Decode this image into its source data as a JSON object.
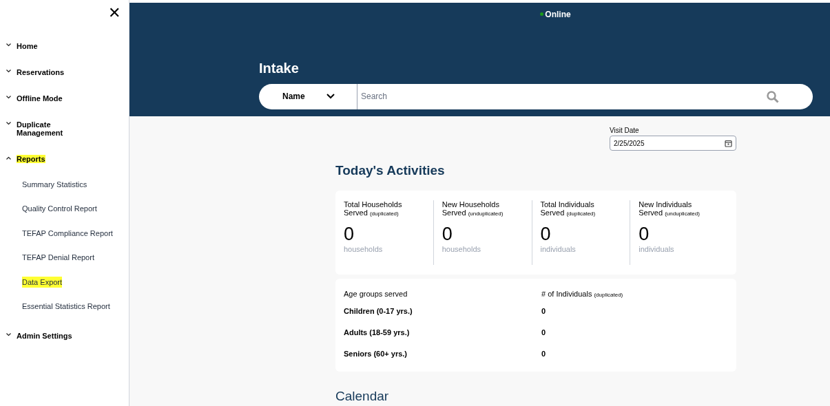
{
  "sidebar": {
    "close": "✕",
    "items": [
      {
        "label": "Home",
        "expanded": false,
        "highlighted": false
      },
      {
        "label": "Reservations",
        "expanded": false,
        "highlighted": false
      },
      {
        "label": "Offline Mode",
        "expanded": false,
        "highlighted": false
      },
      {
        "label": "Duplicate Management",
        "expanded": false,
        "highlighted": false
      },
      {
        "label": "Reports",
        "expanded": true,
        "highlighted": true,
        "children": [
          {
            "label": "Summary Statistics",
            "highlighted": false
          },
          {
            "label": "Quality Control Report",
            "highlighted": false
          },
          {
            "label": "TEFAP Compliance Report",
            "highlighted": false
          },
          {
            "label": "TEFAP Denial Report",
            "highlighted": false
          },
          {
            "label": "Data Export",
            "highlighted": true
          },
          {
            "label": "Essential Statistics Report",
            "highlighted": false
          }
        ]
      },
      {
        "label": "Admin Settings",
        "expanded": false,
        "highlighted": false
      }
    ]
  },
  "status": {
    "label": "Online",
    "online": true
  },
  "header": {
    "title": "Intake",
    "search_by": "Name",
    "search_placeholder": "Search"
  },
  "visit_date": {
    "label": "Visit Date",
    "value": "2/25/2025"
  },
  "activities": {
    "title": "Today's Activities",
    "stats": [
      {
        "label": "Total Households Served",
        "qualifier": "(duplicated)",
        "value": "0",
        "unit": "households"
      },
      {
        "label": "New Households Served",
        "qualifier": "(unduplicated)",
        "value": "0",
        "unit": "households"
      },
      {
        "label": "Total Individuals Served",
        "qualifier": "(duplicated)",
        "value": "0",
        "unit": "individuals"
      },
      {
        "label": "New Individuals Served",
        "qualifier": "(unduplicated)",
        "value": "0",
        "unit": "individuals"
      }
    ]
  },
  "age_groups": {
    "column_1": "Age groups served",
    "column_2": "# of Individuals",
    "column_2_qualifier": "(duplicated)",
    "rows": [
      {
        "group": "Children (0-17 yrs.)",
        "count": "0"
      },
      {
        "group": "Adults (18-59 yrs.)",
        "count": "0"
      },
      {
        "group": "Seniors (60+ yrs.)",
        "count": "0"
      }
    ]
  },
  "calendar": {
    "title": "Calendar"
  }
}
